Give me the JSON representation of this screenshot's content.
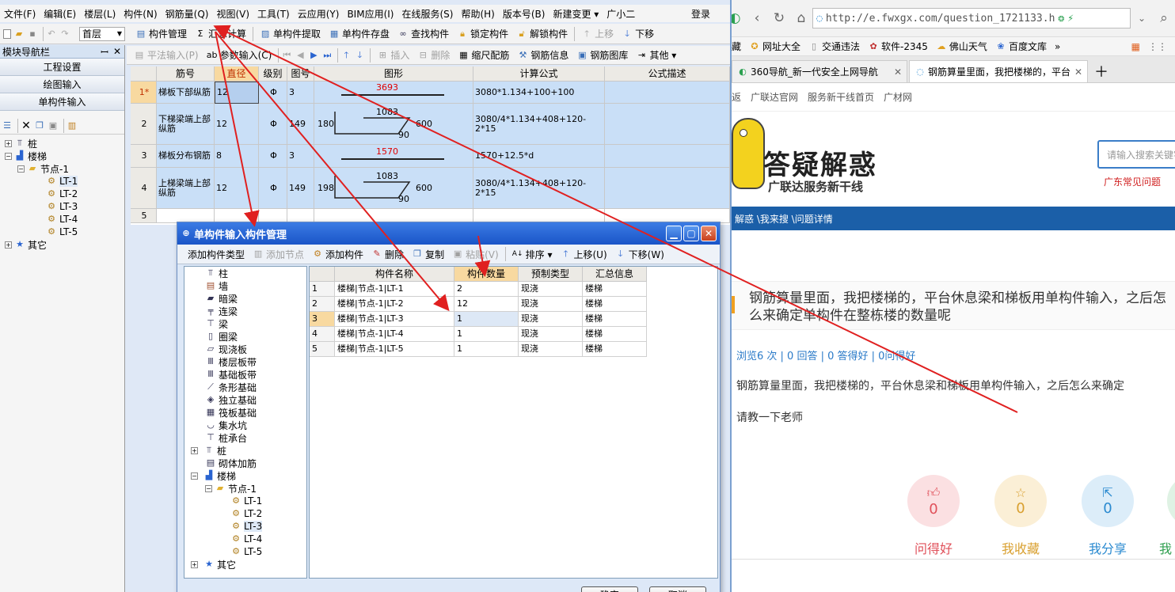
{
  "app": {
    "menu": [
      "文件(F)",
      "编辑(E)",
      "楼层(L)",
      "构件(N)",
      "钢筋量(Q)",
      "视图(V)",
      "工具(T)",
      "云应用(Y)",
      "BIM应用(I)",
      "在线服务(S)",
      "帮助(H)",
      "版本号(B)",
      "新建变更 ▾",
      "广小二"
    ],
    "login": "登录",
    "floor": "首层",
    "toolbar1": [
      "构件管理",
      "汇总计算",
      "单构件提取",
      "单构件存盘",
      "查找构件",
      "锁定构件",
      "解锁构件",
      "上移",
      "下移"
    ],
    "toolbar2": [
      "平法输入(P)",
      "参数输入(C)",
      "插入",
      "删除",
      "缩尺配筋",
      "钢筋信息",
      "钢筋图库",
      "其他 ▾"
    ],
    "nav": {
      "title": "模块导航栏",
      "pin": "ꟷ",
      "close": "✕",
      "buttons": [
        "工程设置",
        "绘图输入",
        "单构件输入"
      ],
      "tree": [
        "桩",
        "楼梯",
        "节点-1",
        "LT-1",
        "LT-2",
        "LT-3",
        "LT-4",
        "LT-5",
        "其它"
      ]
    },
    "grid": {
      "headers": [
        "筋号",
        "直径(mm)",
        "级别",
        "图号",
        "图形",
        "计算公式",
        "公式描述"
      ],
      "rows": [
        {
          "no": "1*",
          "name": "梯板下部纵筋",
          "dia": "12",
          "grade": "Φ",
          "fig": "3",
          "shape": "3693",
          "formula": "3080*1.134+100+100"
        },
        {
          "no": "2",
          "name": "下梯梁端上部纵筋",
          "dia": "12",
          "grade": "Φ",
          "fig": "149",
          "shape_top": "1083",
          "shape_left": "180",
          "shape_right": "600",
          "shape_bottom": "90",
          "formula": "3080/4*1.134+408+120-2*15"
        },
        {
          "no": "3",
          "name": "梯板分布钢筋",
          "dia": "8",
          "grade": "Φ",
          "fig": "3",
          "shape": "1570",
          "formula": "1570+12.5*d"
        },
        {
          "no": "4",
          "name": "上梯梁端上部纵筋",
          "dia": "12",
          "grade": "Φ",
          "fig": "149",
          "shape_top": "1083",
          "shape_left": "198",
          "shape_right": "600",
          "shape_bottom": "90",
          "formula": "3080/4*1.134+408+120-2*15"
        },
        {
          "no": "5",
          "name": "",
          "dia": "",
          "grade": "",
          "fig": "",
          "shape": "",
          "formula": ""
        }
      ]
    }
  },
  "dialog": {
    "title": "单构件输入构件管理",
    "toolbar": [
      "添加构件类型",
      "添加节点",
      "添加构件",
      "删除",
      "复制",
      "粘贴(V)",
      "排序 ▾",
      "上移(U)",
      "下移(W)"
    ],
    "tree": [
      "柱",
      "墙",
      "暗梁",
      "连梁",
      "梁",
      "圈梁",
      "现浇板",
      "楼层板带",
      "基础板带",
      "条形基础",
      "独立基础",
      "筏板基础",
      "集水坑",
      "桩承台",
      "桩",
      "砌体加筋",
      "楼梯",
      "节点-1",
      "LT-1",
      "LT-2",
      "LT-3",
      "LT-4",
      "LT-5",
      "其它"
    ],
    "headers": [
      "构件名称",
      "构件数量",
      "预制类型",
      "汇总信息"
    ],
    "rows": [
      {
        "no": "1",
        "name": "楼梯|节点-1|LT-1",
        "qty": "2",
        "type": "现浇",
        "sum": "楼梯"
      },
      {
        "no": "2",
        "name": "楼梯|节点-1|LT-2",
        "qty": "12",
        "type": "现浇",
        "sum": "楼梯"
      },
      {
        "no": "3",
        "name": "楼梯|节点-1|LT-3",
        "qty": "1",
        "type": "现浇",
        "sum": "楼梯"
      },
      {
        "no": "4",
        "name": "楼梯|节点-1|LT-4",
        "qty": "1",
        "type": "现浇",
        "sum": "楼梯"
      },
      {
        "no": "5",
        "name": "楼梯|节点-1|LT-5",
        "qty": "1",
        "type": "现浇",
        "sum": "楼梯"
      }
    ],
    "ok": "确定",
    "cancel": "取消"
  },
  "browser": {
    "url": "http://e.fwxgx.com/question_1721133.h",
    "bookmarks": [
      "藏",
      "网址大全",
      "交通违法",
      "软件-2345",
      "佛山天气",
      "百度文库",
      "»"
    ],
    "tabs": [
      "360导航_新一代安全上网导航",
      "钢筋算量里面，我把楼梯的，平台"
    ],
    "site_nav": [
      "返",
      "广联达官网",
      "服务新干线首页",
      "广材网"
    ],
    "logo_title": "答疑解惑",
    "logo_sub": "广联达服务新干线",
    "search_placeholder": "请输入搜索关键字",
    "region_link": "广东常见问题",
    "breadcrumb": "解惑 \\我来搜 \\问题详情",
    "question_title": "钢筋算量里面，我把楼梯的，平台休息梁和梯板用单构件输入，之后怎么来确定单构件在整栋楼的数量呢",
    "stats": "浏览6 次 | 0 回答 | 0 答得好 | 0问得好",
    "question_body": "钢筋算量里面，我把楼梯的，平台休息梁和梯板用单构件输入，之后怎么来确定",
    "question_body2": "请教一下老师",
    "actions": [
      {
        "label": "问得好",
        "count": "0",
        "color": "#e0505a",
        "bg": "#fbe0e2"
      },
      {
        "label": "我收藏",
        "count": "0",
        "color": "#d9a030",
        "bg": "#fbefd6"
      },
      {
        "label": "我分享",
        "count": "0",
        "color": "#2a8ad0",
        "bg": "#dcedf9"
      },
      {
        "label": "我",
        "count": "",
        "color": "#30a050",
        "bg": "#dff2e4"
      }
    ]
  }
}
